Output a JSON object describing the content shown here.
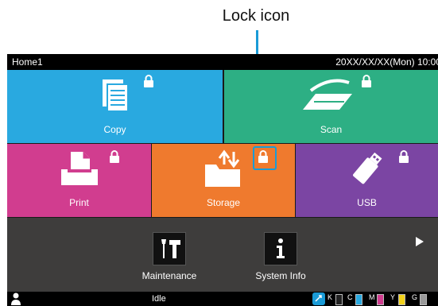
{
  "callout": {
    "text": "Lock icon"
  },
  "status_bar": {
    "home": "Home1",
    "datetime": "20XX/XX/XX(Mon) 10:00"
  },
  "tiles": {
    "copy": {
      "label": "Copy"
    },
    "scan": {
      "label": "Scan"
    },
    "print": {
      "label": "Print"
    },
    "storage": {
      "label": "Storage"
    },
    "usb": {
      "label": "USB"
    }
  },
  "functions": {
    "maintenance": {
      "label": "Maintenance"
    },
    "system_info": {
      "label": "System Info"
    }
  },
  "bottom_bar": {
    "status": "Idle",
    "ink": [
      {
        "letter": "K",
        "color": "#222222"
      },
      {
        "letter": "C",
        "color": "#29a9e0"
      },
      {
        "letter": "M",
        "color": "#d13d8f"
      },
      {
        "letter": "Y",
        "color": "#f2d21b"
      },
      {
        "letter": "G",
        "color": "#9a9a9a"
      }
    ]
  },
  "colors": {
    "copy": "#29a9e0",
    "scan": "#2daf84",
    "print": "#d13d8f",
    "storage": "#ef7a2e",
    "usb": "#7b45a3",
    "highlight": "#1a9bd7"
  }
}
